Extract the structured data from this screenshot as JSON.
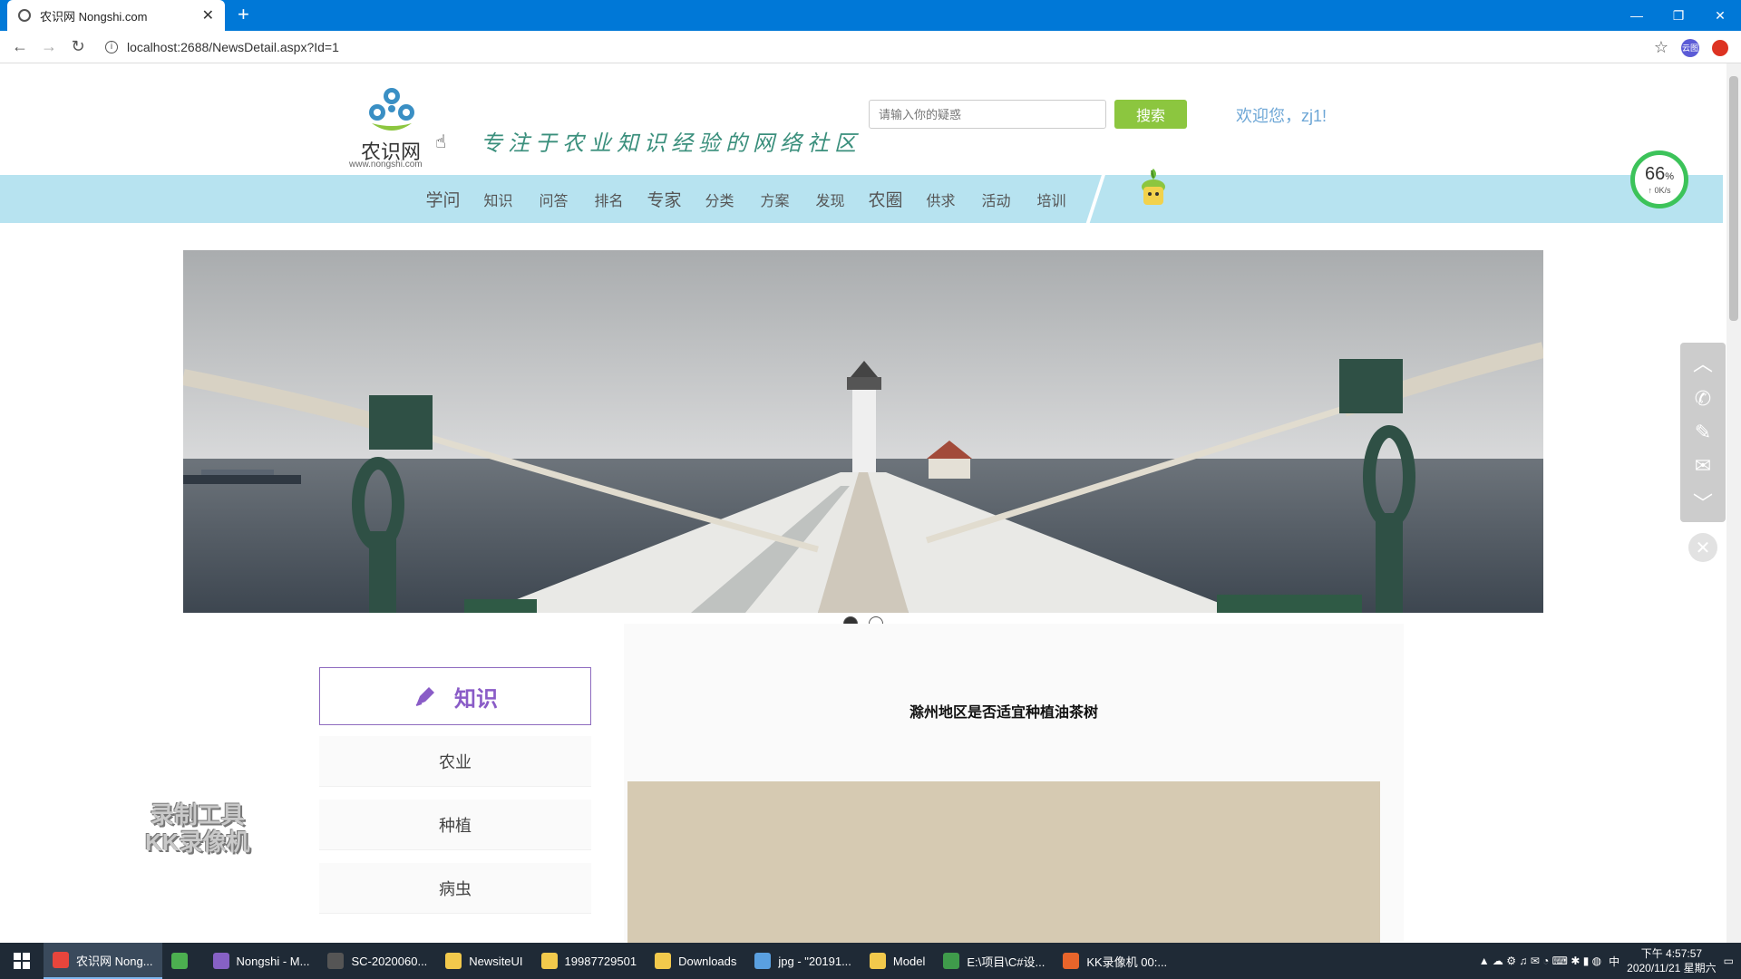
{
  "browser": {
    "tab_title": "农识网 Nongshi.com",
    "tab_close": "✕",
    "new_tab": "+",
    "url": "localhost:2688/NewsDetail.aspx?Id=1",
    "ext_badge": "云图"
  },
  "header": {
    "logo_text": "农识网",
    "logo_url": "www.nongshi.com",
    "slogan": "专注于农业知识经验的网络社区",
    "search": {
      "placeholder": "请输入你的疑惑",
      "button_label": "搜索"
    },
    "welcome": "欢迎您，zj1!"
  },
  "nav": {
    "items": [
      "学问",
      "知识",
      "问答",
      "排名",
      "专家",
      "分类",
      "方案",
      "发现",
      "农圈",
      "供求",
      "活动",
      "培训"
    ]
  },
  "speed_meter": {
    "percent": "66",
    "percent_unit": "%",
    "speed": "↑ 0K/s"
  },
  "banner": {
    "slides": 2,
    "active_slide": 1
  },
  "side_tools": [
    "up",
    "phone",
    "edit",
    "mail",
    "down"
  ],
  "panel": {
    "title": "知识",
    "categories": [
      "农业",
      "种植",
      "病虫"
    ]
  },
  "article": {
    "title": "滁州地区是否适宜种植油茶树"
  },
  "watermark": {
    "line1": "录制工具",
    "line2": "KK录像机"
  },
  "taskbar": {
    "items": [
      {
        "label": "农识网 Nong...",
        "color": "#e8453c",
        "active": true
      },
      {
        "label": "",
        "color": "#4caf50",
        "active": false
      },
      {
        "label": "Nongshi - M...",
        "color": "#8661c5",
        "active": false
      },
      {
        "label": "SC-2020060...",
        "color": "#555555",
        "active": false
      },
      {
        "label": "NewsiteUI",
        "color": "#f2c94c",
        "active": false
      },
      {
        "label": "19987729501",
        "color": "#f2c94c",
        "active": false
      },
      {
        "label": "Downloads",
        "color": "#f2c94c",
        "active": false
      },
      {
        "label": "jpg - \"20191...",
        "color": "#5aa0e0",
        "active": false
      },
      {
        "label": "Model",
        "color": "#f2c94c",
        "active": false
      },
      {
        "label": "E:\\项目\\C#设...",
        "color": "#3f9b4b",
        "active": false
      },
      {
        "label": "KK录像机 00:...",
        "color": "#e8652b",
        "active": false
      }
    ],
    "ime": "中",
    "time": "下午 4:57:57",
    "date": "2020/11/21 星期六"
  }
}
